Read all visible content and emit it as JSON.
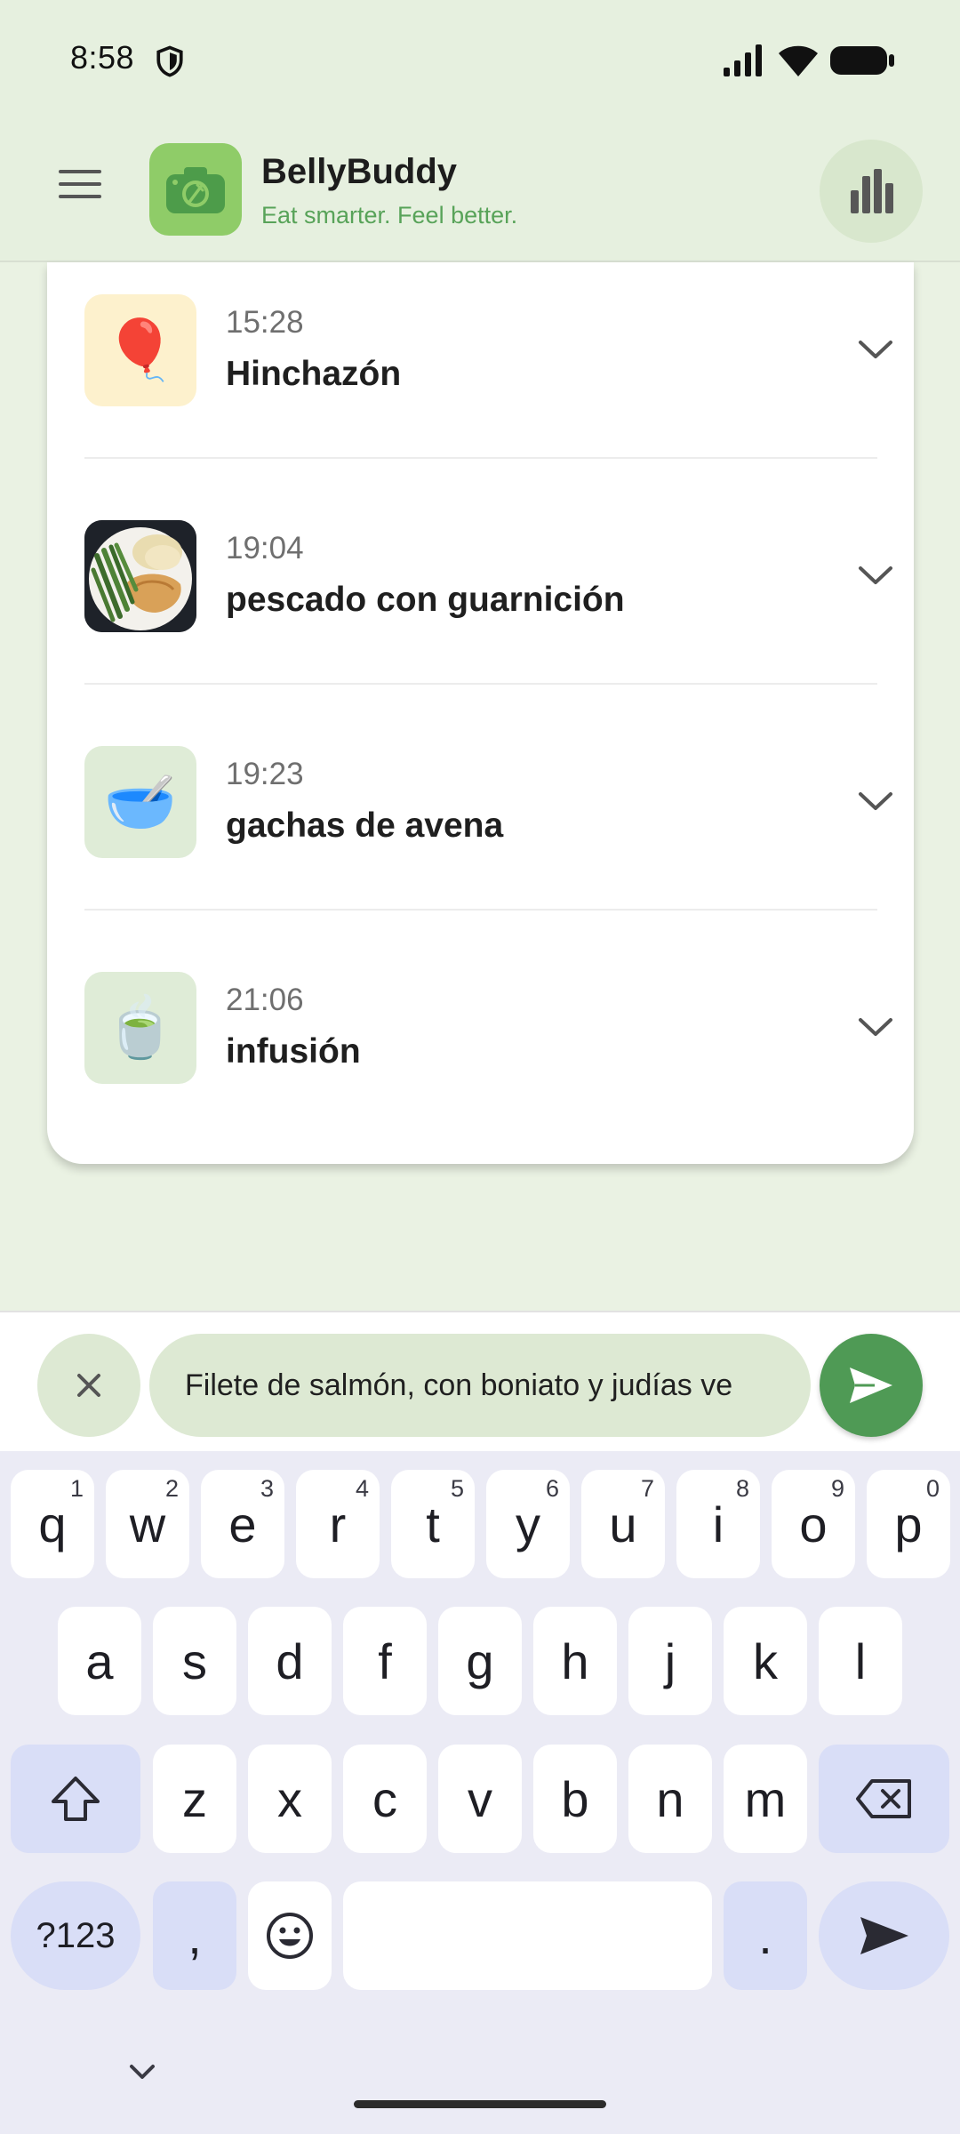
{
  "status_bar": {
    "time": "8:58",
    "icons": [
      "shield-icon",
      "signal-icon",
      "wifi-icon",
      "battery-icon"
    ]
  },
  "app_bar": {
    "title": "BellyBuddy",
    "subtitle": "Eat smarter. Feel better.",
    "menu_icon": "hamburger-menu-icon",
    "logo_icon": "camera-fork-icon",
    "stats_icon": "bar-chart-icon"
  },
  "entries": [
    {
      "time": "15:28",
      "title": "Hinchazón",
      "thumb": "🎈",
      "icon": "balloon-icon"
    },
    {
      "time": "19:04",
      "title": "pescado con guarnición",
      "thumb": "photo",
      "icon": "meal-photo"
    },
    {
      "time": "19:23",
      "title": "gachas de avena",
      "thumb": "🥣",
      "icon": "bowl-icon"
    },
    {
      "time": "21:06",
      "title": "infusión",
      "thumb": "🍵",
      "icon": "tea-cup-icon"
    }
  ],
  "input": {
    "value": "Filete de salmón, con boniato y judías ve",
    "clear_icon": "close-icon",
    "send_icon": "send-icon"
  },
  "keyboard": {
    "row1": [
      {
        "key": "q",
        "hint": "1"
      },
      {
        "key": "w",
        "hint": "2"
      },
      {
        "key": "e",
        "hint": "3"
      },
      {
        "key": "r",
        "hint": "4"
      },
      {
        "key": "t",
        "hint": "5"
      },
      {
        "key": "y",
        "hint": "6"
      },
      {
        "key": "u",
        "hint": "7"
      },
      {
        "key": "i",
        "hint": "8"
      },
      {
        "key": "o",
        "hint": "9"
      },
      {
        "key": "p",
        "hint": "0"
      }
    ],
    "row2": [
      "a",
      "s",
      "d",
      "f",
      "g",
      "h",
      "j",
      "k",
      "l"
    ],
    "row3": [
      "z",
      "x",
      "c",
      "v",
      "b",
      "n",
      "m"
    ],
    "symbols_label": "?123",
    "comma_label": ",",
    "period_label": ".",
    "colors": {
      "key": "#ffffff",
      "special": "#d9def7",
      "background": "#ebebf5",
      "accent": "#4f9a55"
    }
  }
}
